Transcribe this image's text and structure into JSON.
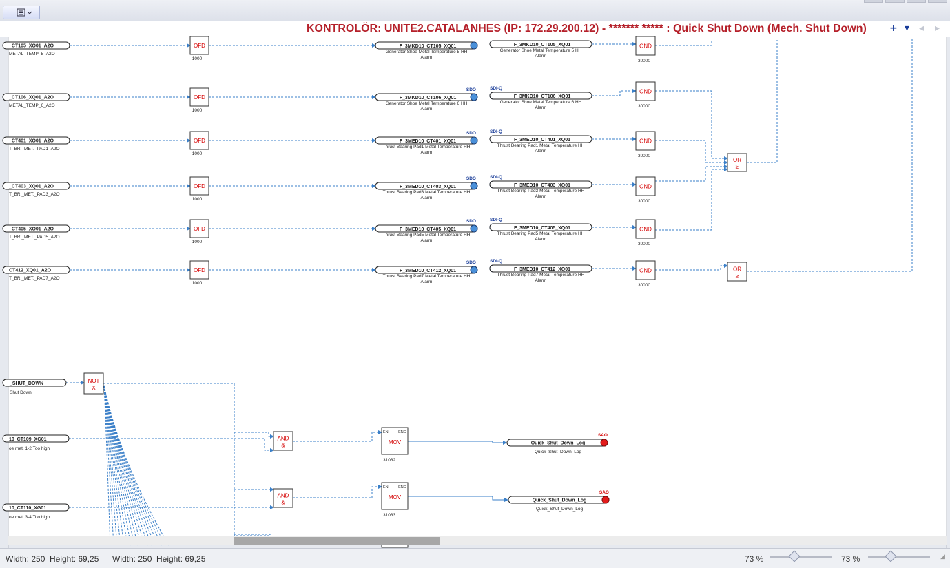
{
  "header": {
    "title": "KONTROLÖR: UNITE2.CATALANHES (IP: 172.29.200.12) - ******* ***** : Quick Shut Down (Mech. Shut  Down)",
    "nav_add": "+",
    "nav_down": "▾",
    "nav_prev": "◂",
    "nav_next": "▸"
  },
  "toolbar": {
    "view_icon": "list-view-icon"
  },
  "rows": [
    {
      "in_tag": "_CT105_XQ01_A2O",
      "in_desc": "METAL_TEMP_5_A2O",
      "ofd": "OFD",
      "ofd_num": "1000",
      "sdo_label": "",
      "sdo_tag": "F_3MKD10_CT105_XQ01",
      "sdo_desc1": "Generator Shoe Metal Temperature 5 HH",
      "sdo_desc2": "Alarm",
      "sdi_label": "",
      "sdi_tag": "F_3MKD10_CT105_XQ01",
      "sdi_desc1": "Generator Shoe Metal Temperature 5 HH",
      "sdi_desc2": "Alarm",
      "ond": "OND",
      "ond_num": "30000"
    },
    {
      "in_tag": "_CT106_XQ01_A2O",
      "in_desc": "METAL_TEMP_6_A2O",
      "ofd": "OFD",
      "ofd_num": "1000",
      "sdo_label": "SDO",
      "sdo_tag": "F_3MKD10_CT106_XQ01",
      "sdo_desc1": "Generator Shoe Metal Temperature 6 HH",
      "sdo_desc2": "Alarm",
      "sdi_label": "SDI-Q",
      "sdi_tag": "F_3MKD10_CT106_XQ01",
      "sdi_desc1": "Generator Shoe Metal Temperature 6 HH",
      "sdi_desc2": "Alarm",
      "ond": "OND",
      "ond_num": "30000"
    },
    {
      "in_tag": "_CT401_XQ01_A2O",
      "in_desc": "T_BR._MET._PAD1_A2O",
      "ofd": "OFD",
      "ofd_num": "1000",
      "sdo_label": "SDO",
      "sdo_tag": "F_3MED10_CT401_XQ01",
      "sdo_desc1": "Thrust Bearing Pad1 Metal Temperature HH",
      "sdo_desc2": "Alarm",
      "sdi_label": "SDI-Q",
      "sdi_tag": "F_3MED10_CT401_XQ01",
      "sdi_desc1": "Thrust Bearing Pad1 Metal Temperature HH",
      "sdi_desc2": "Alarm",
      "ond": "OND",
      "ond_num": "30000"
    },
    {
      "in_tag": "_CT403_XQ01_A2O",
      "in_desc": "T_BR._MET._PAD3_A2O",
      "ofd": "OFD",
      "ofd_num": "1000",
      "sdo_label": "SDO",
      "sdo_tag": "F_3MED10_CT403_XQ01",
      "sdo_desc1": "Thrust Bearing Pad3 Metal Temperature HH",
      "sdo_desc2": "Alarm",
      "sdi_label": "SDI-Q",
      "sdi_tag": "F_3MED10_CT403_XQ01",
      "sdi_desc1": "Thrust Bearing Pad3 Metal Temperature HH",
      "sdi_desc2": "Alarm",
      "ond": "OND",
      "ond_num": "30000"
    },
    {
      "in_tag": "_CT405_XQ01_A2O",
      "in_desc": "T_BR._MET._PAD5_A2O",
      "ofd": "OFD",
      "ofd_num": "1000",
      "sdo_label": "SDO",
      "sdo_tag": "F_3MED10_CT405_XQ01",
      "sdo_desc1": "Thrust Bearing Pad5 Metal Temperature HH",
      "sdo_desc2": "Alarm",
      "sdi_label": "SDI-Q",
      "sdi_tag": "F_3MED10_CT405_XQ01",
      "sdi_desc1": "Thrust Bearing Pad5 Metal Temperature HH",
      "sdi_desc2": "Alarm",
      "ond": "OND",
      "ond_num": "30000"
    },
    {
      "in_tag": "CT412_XQ01_A2O",
      "in_desc": "T_BR._MET._PAD7_A2O",
      "ofd": "OFD",
      "ofd_num": "1000",
      "sdo_label": "SDO",
      "sdo_tag": "F_3MED10_CT412_XQ01",
      "sdo_desc1": "Thrust Bearing Pad7 Metal Temperature HH",
      "sdo_desc2": "Alarm",
      "sdi_label": "SDI-Q",
      "sdi_tag": "F_3MED10_CT412_XQ01",
      "sdi_desc1": "Thrust Bearing Pad7 Metal Temperature HH",
      "sdi_desc2": "Alarm",
      "ond": "OND",
      "ond_num": "30000"
    }
  ],
  "or_gates": [
    {
      "label": "OR",
      "symbol": "≥"
    },
    {
      "label": "OR",
      "symbol": "≥"
    }
  ],
  "lower": {
    "shutdown_tag": "_SHUT_DOWN",
    "shutdown_desc": "Shut Down",
    "not_label": "NOT",
    "not_symbol": "X",
    "in1_tag": "10_CT109_XG01",
    "in1_desc": "oe met. 1-2 Too high",
    "in2_tag": "10_CT110_XG01",
    "in2_desc": "oe met. 3-4 Too high",
    "and_label": "AND",
    "and_symbol": "&",
    "mov_label": "MOV",
    "en_label": "EN",
    "eno_label": "ENO",
    "mov1_num": "31032",
    "mov2_num": "31033",
    "sao_label": "SAO",
    "log_tag": "Quick_Shut_Down_Log",
    "log_desc": "Quick_Shut_Down_Log"
  },
  "status": {
    "w1": "Width: 250",
    "h1": "Height: 69,25",
    "w2": "Width: 250",
    "h2": "Height: 69,25",
    "zoom1": "73 %",
    "zoom2": "73 %"
  },
  "colors": {
    "title": "#b5202a",
    "block_text": "#d40000",
    "wire": "#3a7fc8",
    "pin_blue": "#4a90d9",
    "pin_red": "#e31b1b",
    "label_blue": "#1a3d99"
  }
}
